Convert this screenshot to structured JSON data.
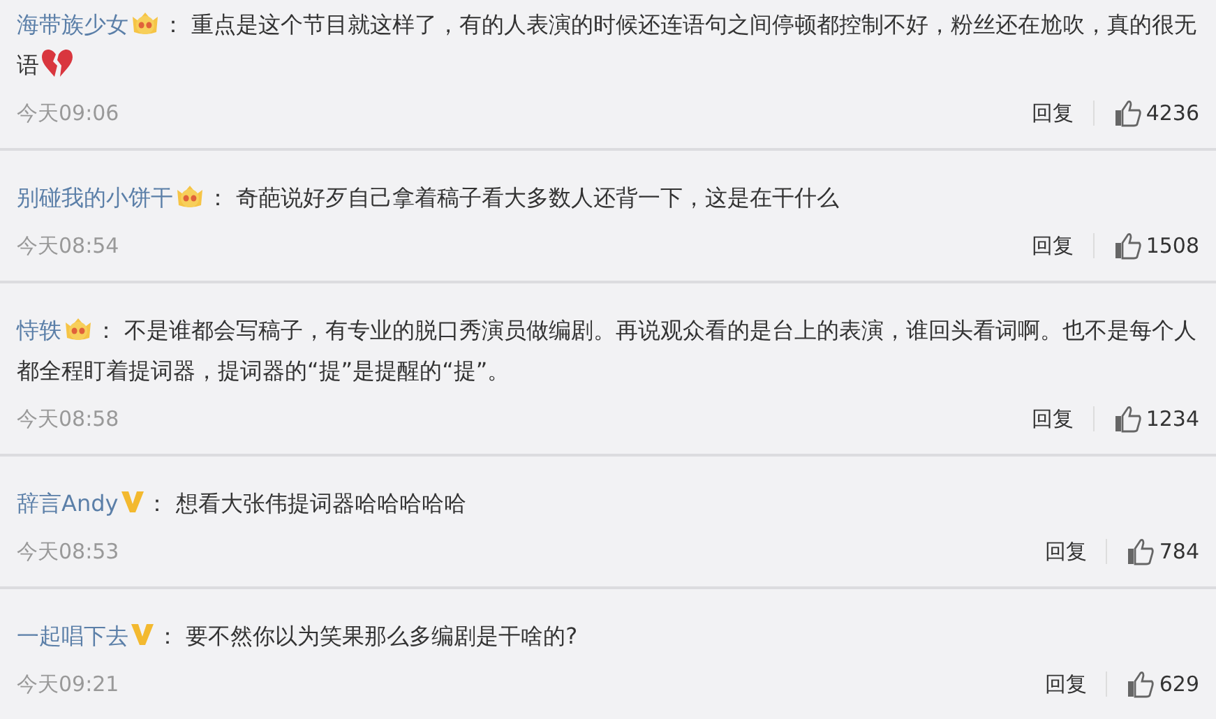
{
  "comments": [
    {
      "user": "海带族少女",
      "kind": "crown",
      "colon": "：",
      "text": "重点是这个节目就这样了，有的人表演的时候还连语句之间停顿都控制不好，粉丝还在尬吹，真的很无语",
      "broken_heart": true,
      "time": "今天09:06",
      "reply": "回复",
      "likes": "4236"
    },
    {
      "user": "别碰我的小饼干",
      "kind": "crown",
      "colon": "：",
      "text": "奇葩说好歹自己拿着稿子看大多数人还背一下，这是在干什么",
      "broken_heart": false,
      "time": "今天08:54",
      "reply": "回复",
      "likes": "1508"
    },
    {
      "user": "恃轶",
      "kind": "crown",
      "colon": "：",
      "text": "不是谁都会写稿子，有专业的脱口秀演员做编剧。再说观众看的是台上的表演，谁回头看词啊。也不是每个人都全程盯着提词器，提词器的“提”是提醒的“提”。",
      "broken_heart": false,
      "time": "今天08:58",
      "reply": "回复",
      "likes": "1234"
    },
    {
      "user": "辞言Andy",
      "kind": "vip",
      "colon": "：",
      "text": "想看大张伟提词器哈哈哈哈哈",
      "broken_heart": false,
      "time": "今天08:53",
      "reply": "回复",
      "likes": "784"
    },
    {
      "user": "一起唱下去",
      "kind": "vip",
      "colon": "：",
      "text": "要不然你以为笑果那么多编剧是干啥的?",
      "broken_heart": false,
      "time": "今天09:21",
      "reply": "回复",
      "likes": "629"
    }
  ]
}
